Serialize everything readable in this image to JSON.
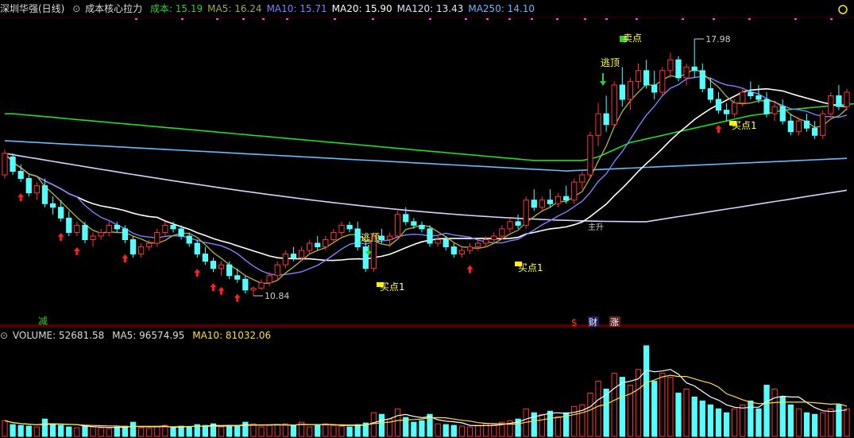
{
  "header": {
    "stock": "深圳华强(日线)",
    "indicator": "成本核心拉力",
    "values": [
      {
        "label": "成本:",
        "value": "15.19",
        "color": "#33cc33"
      },
      {
        "label": "MA5:",
        "value": "16.24",
        "color": "#a8a840"
      },
      {
        "label": "MA10:",
        "value": "15.71",
        "color": "#8080ff"
      },
      {
        "label": "MA20:",
        "value": "15.90",
        "color": "#ffffff"
      },
      {
        "label": "MA120:",
        "value": "13.43",
        "color": "#e0e0ff"
      },
      {
        "label": "MA250:",
        "value": "14.10",
        "color": "#66bbff"
      }
    ]
  },
  "volume_header": {
    "title": "VOLUME: 52681.58",
    "ma5": "MA5: 96574.95",
    "ma10": "MA10: 81032.06"
  },
  "labels": {
    "high": "17.98",
    "low": "10.84",
    "escape_top": "逃顶",
    "sell": "卖点",
    "buy1": "买点1",
    "reduce": "减",
    "tag_s": "$",
    "tag_cai": "财",
    "tag_zhang": "涨",
    "chan": "主升"
  },
  "colors": {
    "up": "#ff3333",
    "down": "#54ffff",
    "cost": "#22dd22",
    "ma5": "#a8a840",
    "ma10": "#8080ff",
    "ma20": "#ffffff",
    "ma120": "#d8d0ff",
    "ma250": "#66bbff"
  },
  "chart_data": {
    "type": "candlestick",
    "ylim": [
      10.4,
      18.4
    ],
    "candles": [
      [
        14.2,
        14.9,
        14.1,
        14.8
      ],
      [
        14.7,
        14.8,
        14.2,
        14.3
      ],
      [
        14.3,
        14.5,
        14.0,
        14.1
      ],
      [
        14.1,
        14.2,
        13.6,
        13.7
      ],
      [
        13.7,
        14.0,
        13.5,
        13.9
      ],
      [
        13.9,
        14.1,
        13.3,
        13.4
      ],
      [
        13.4,
        13.6,
        13.1,
        13.3
      ],
      [
        13.3,
        13.5,
        12.9,
        13.0
      ],
      [
        13.0,
        13.2,
        12.5,
        12.6
      ],
      [
        12.6,
        12.9,
        12.5,
        12.8
      ],
      [
        12.8,
        12.9,
        12.3,
        12.4
      ],
      [
        12.4,
        12.6,
        12.2,
        12.5
      ],
      [
        12.5,
        12.7,
        12.4,
        12.6
      ],
      [
        12.6,
        12.9,
        12.5,
        12.8
      ],
      [
        12.8,
        12.9,
        12.6,
        12.7
      ],
      [
        12.7,
        12.8,
        12.3,
        12.4
      ],
      [
        12.4,
        12.5,
        11.9,
        12.0
      ],
      [
        12.0,
        12.3,
        11.9,
        12.2
      ],
      [
        12.2,
        12.4,
        12.1,
        12.3
      ],
      [
        12.3,
        12.7,
        12.2,
        12.6
      ],
      [
        12.6,
        12.9,
        12.5,
        12.8
      ],
      [
        12.8,
        12.9,
        12.6,
        12.7
      ],
      [
        12.7,
        12.8,
        12.4,
        12.5
      ],
      [
        12.5,
        12.6,
        12.2,
        12.3
      ],
      [
        12.3,
        12.4,
        11.9,
        12.0
      ],
      [
        12.0,
        12.2,
        11.7,
        11.8
      ],
      [
        11.8,
        11.9,
        11.5,
        11.6
      ],
      [
        11.6,
        11.8,
        11.4,
        11.7
      ],
      [
        11.7,
        11.8,
        11.3,
        11.4
      ],
      [
        11.4,
        11.6,
        11.2,
        11.3
      ],
      [
        11.3,
        11.4,
        10.9,
        11.0
      ],
      [
        11.0,
        11.1,
        10.84,
        11.05
      ],
      [
        11.05,
        11.3,
        11.0,
        11.2
      ],
      [
        11.2,
        11.5,
        11.1,
        11.4
      ],
      [
        11.4,
        11.8,
        11.3,
        11.7
      ],
      [
        11.7,
        12.1,
        11.6,
        12.0
      ],
      [
        12.0,
        12.2,
        11.8,
        11.9
      ],
      [
        11.9,
        12.2,
        11.8,
        12.1
      ],
      [
        12.1,
        12.4,
        12.0,
        12.3
      ],
      [
        12.3,
        12.5,
        12.1,
        12.2
      ],
      [
        12.2,
        12.5,
        12.1,
        12.4
      ],
      [
        12.4,
        12.7,
        12.3,
        12.6
      ],
      [
        12.6,
        12.9,
        12.5,
        12.8
      ],
      [
        12.8,
        12.9,
        12.6,
        12.7
      ],
      [
        12.7,
        12.9,
        12.1,
        12.2
      ],
      [
        12.2,
        12.4,
        11.5,
        11.6
      ],
      [
        11.6,
        12.6,
        11.5,
        12.5
      ],
      [
        12.5,
        12.7,
        12.3,
        12.4
      ],
      [
        12.4,
        12.6,
        12.2,
        12.5
      ],
      [
        12.5,
        13.2,
        12.4,
        13.1
      ],
      [
        13.1,
        13.3,
        12.8,
        12.9
      ],
      [
        12.9,
        13.0,
        12.7,
        12.8
      ],
      [
        12.8,
        12.9,
        12.6,
        12.7
      ],
      [
        12.7,
        12.8,
        12.2,
        12.3
      ],
      [
        12.3,
        12.5,
        12.2,
        12.4
      ],
      [
        12.4,
        12.5,
        12.1,
        12.2
      ],
      [
        12.2,
        12.3,
        11.9,
        12.0
      ],
      [
        12.0,
        12.2,
        11.9,
        12.1
      ],
      [
        12.1,
        12.3,
        12.0,
        12.2
      ],
      [
        12.2,
        12.4,
        12.1,
        12.3
      ],
      [
        12.3,
        12.5,
        12.2,
        12.4
      ],
      [
        12.4,
        12.6,
        12.3,
        12.5
      ],
      [
        12.5,
        12.8,
        12.4,
        12.7
      ],
      [
        12.7,
        13.0,
        12.6,
        12.9
      ],
      [
        12.9,
        13.1,
        12.7,
        12.8
      ],
      [
        12.8,
        13.6,
        12.7,
        13.5
      ],
      [
        13.5,
        13.8,
        13.2,
        13.3
      ],
      [
        13.3,
        13.6,
        13.2,
        13.5
      ],
      [
        13.5,
        13.8,
        13.3,
        13.4
      ],
      [
        13.4,
        13.7,
        13.3,
        13.6
      ],
      [
        13.6,
        13.9,
        13.4,
        13.5
      ],
      [
        13.5,
        14.1,
        13.4,
        14.0
      ],
      [
        14.0,
        14.3,
        13.8,
        14.2
      ],
      [
        14.2,
        15.4,
        14.1,
        15.3
      ],
      [
        15.3,
        16.2,
        15.0,
        15.9
      ],
      [
        15.9,
        16.4,
        15.4,
        15.6
      ],
      [
        15.6,
        16.8,
        15.5,
        16.7
      ],
      [
        16.7,
        17.2,
        16.1,
        16.3
      ],
      [
        16.3,
        16.9,
        16.0,
        16.8
      ],
      [
        16.8,
        17.3,
        16.6,
        17.1
      ],
      [
        17.1,
        17.4,
        16.6,
        16.7
      ],
      [
        16.7,
        17.1,
        16.3,
        16.5
      ],
      [
        16.5,
        17.2,
        16.4,
        17.1
      ],
      [
        17.1,
        17.6,
        16.9,
        17.4
      ],
      [
        17.4,
        17.5,
        16.8,
        16.9
      ],
      [
        16.9,
        17.3,
        16.7,
        17.2
      ],
      [
        17.2,
        17.98,
        16.9,
        17.1
      ],
      [
        17.1,
        17.3,
        16.5,
        16.6
      ],
      [
        16.6,
        16.9,
        16.2,
        16.3
      ],
      [
        16.3,
        16.5,
        15.9,
        16.0
      ],
      [
        16.0,
        16.2,
        15.7,
        15.9
      ],
      [
        15.9,
        16.3,
        15.8,
        16.2
      ],
      [
        16.2,
        16.6,
        16.1,
        16.5
      ],
      [
        16.5,
        16.8,
        16.3,
        16.4
      ],
      [
        16.4,
        16.7,
        16.2,
        16.3
      ],
      [
        16.3,
        16.5,
        15.8,
        15.9
      ],
      [
        15.9,
        16.2,
        15.7,
        16.1
      ],
      [
        16.1,
        16.3,
        15.6,
        15.7
      ],
      [
        15.7,
        15.9,
        15.3,
        15.4
      ],
      [
        15.4,
        15.8,
        15.3,
        15.7
      ],
      [
        15.7,
        15.9,
        15.4,
        15.5
      ],
      [
        15.5,
        15.7,
        15.2,
        15.3
      ],
      [
        15.3,
        16.0,
        15.2,
        15.9
      ],
      [
        15.9,
        16.5,
        15.8,
        16.4
      ],
      [
        16.4,
        16.7,
        16.0,
        16.1
      ],
      [
        16.1,
        16.6,
        16.0,
        16.5
      ]
    ],
    "cost": [
      15.9,
      15.9,
      15.88,
      15.86,
      15.84,
      15.82,
      15.8,
      15.78,
      15.76,
      15.74,
      15.72,
      15.7,
      15.68,
      15.66,
      15.64,
      15.62,
      15.6,
      15.58,
      15.56,
      15.54,
      15.52,
      15.5,
      15.48,
      15.46,
      15.44,
      15.42,
      15.4,
      15.38,
      15.36,
      15.34,
      15.32,
      15.3,
      15.28,
      15.26,
      15.24,
      15.22,
      15.2,
      15.18,
      15.16,
      15.14,
      15.12,
      15.1,
      15.08,
      15.06,
      15.04,
      15.02,
      15.0,
      14.98,
      14.96,
      14.94,
      14.92,
      14.9,
      14.88,
      14.86,
      14.84,
      14.82,
      14.8,
      14.78,
      14.76,
      14.74,
      14.72,
      14.7,
      14.68,
      14.66,
      14.64,
      14.62,
      14.6,
      14.6,
      14.6,
      14.6,
      14.6,
      14.6,
      14.6,
      14.65,
      14.7,
      14.8,
      14.9,
      15.0,
      15.1,
      15.15,
      15.2,
      15.25,
      15.3,
      15.35,
      15.4,
      15.45,
      15.5,
      15.55,
      15.6,
      15.65,
      15.7,
      15.75,
      15.8,
      15.85,
      15.88,
      15.9,
      15.95,
      16.0,
      16.02,
      16.04,
      16.06,
      16.08,
      16.1,
      16.12,
      16.14,
      16.16,
      16.18,
      16.2
    ],
    "volume_ylim": [
      0,
      120000
    ],
    "volume": [
      20000,
      15000,
      14000,
      13000,
      12000,
      22000,
      16000,
      14000,
      12000,
      11000,
      13000,
      12000,
      11000,
      10000,
      12000,
      13000,
      18000,
      11000,
      10000,
      12000,
      14000,
      11000,
      13000,
      12000,
      15000,
      14000,
      16000,
      12000,
      13000,
      14000,
      18000,
      16000,
      12000,
      14000,
      15000,
      16000,
      14000,
      18000,
      12000,
      15000,
      16000,
      14000,
      13000,
      12000,
      15000,
      17000,
      30000,
      28000,
      22000,
      35000,
      24000,
      18000,
      20000,
      28000,
      16000,
      15000,
      14000,
      13000,
      12000,
      14000,
      16000,
      15000,
      18000,
      20000,
      22000,
      35000,
      30000,
      28000,
      32000,
      25000,
      30000,
      38000,
      40000,
      55000,
      70000,
      60000,
      80000,
      75000,
      65000,
      85000,
      115000,
      70000,
      80000,
      75000,
      55000,
      60000,
      50000,
      45000,
      40000,
      35000,
      30000,
      35000,
      40000,
      45000,
      35000,
      65000,
      60000,
      50000,
      40000,
      35000,
      30000,
      28000,
      30000,
      35000,
      40000,
      35000
    ]
  }
}
